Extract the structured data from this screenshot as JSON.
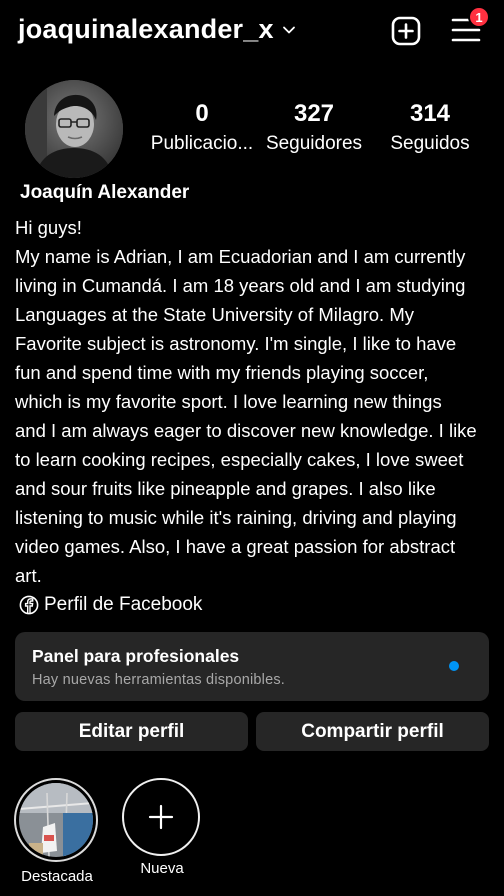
{
  "header": {
    "username": "joaquinalexander_x",
    "notification_count": "1"
  },
  "stats": [
    {
      "value": "0",
      "label": "Publicacio..."
    },
    {
      "value": "327",
      "label": "Seguidores"
    },
    {
      "value": "314",
      "label": "Seguidos"
    }
  ],
  "profile": {
    "full_name": "Joaquín Alexander",
    "bio_lines": [
      "Hi guys!",
      "My name is Adrian, I am Ecuadorian and I am currently",
      "living in Cumandá. I am 18 years old and I am studying",
      "Languages at the State University of Milagro. My",
      "Favorite subject is astronomy. I'm single, I like to have",
      "fun and spend time with my friends playing soccer,",
      "which is my favorite sport. I love learning new things",
      "and I am always eager to discover new knowledge. I like",
      "to learn cooking recipes, especially cakes, I love sweet",
      "and sour fruits like pineapple and grapes. I also like",
      "listening to music while it's raining, driving and playing",
      "video games. Also, I have a great passion for abstract",
      "art."
    ],
    "facebook_link": "Perfil de Facebook"
  },
  "panel": {
    "title": "Panel para profesionales",
    "subtitle": "Hay nuevas herramientas disponibles."
  },
  "buttons": {
    "edit": "Editar perfil",
    "share": "Compartir perfil"
  },
  "highlights": [
    {
      "label": "Destacada"
    },
    {
      "label": "Nueva"
    }
  ],
  "icons": [
    "chevron-down-icon",
    "new-post-icon",
    "menu-icon",
    "facebook-icon",
    "plus-icon"
  ],
  "colors": {
    "badge": "#ff3040",
    "dot": "#0095f6",
    "surface": "#262626"
  }
}
